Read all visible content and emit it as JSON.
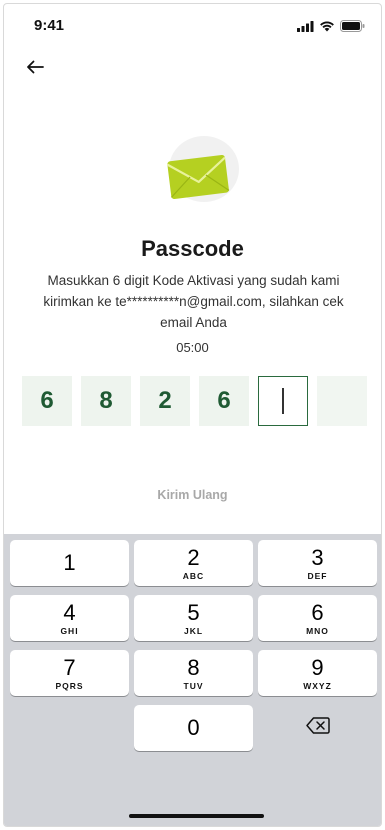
{
  "status_bar": {
    "time": "9:41"
  },
  "page": {
    "title": "Passcode",
    "subtitle": "Masukkan 6 digit Kode Aktivasi yang sudah kami kirimkan ke te**********n@gmail.com, silahkan cek email Anda",
    "timer": "05:00",
    "resend_label": "Kirim Ulang"
  },
  "otp": {
    "digits": [
      "6",
      "8",
      "2",
      "6",
      "",
      ""
    ],
    "active_index": 4
  },
  "keyboard": {
    "keys": [
      {
        "digit": "1",
        "letters": ""
      },
      {
        "digit": "2",
        "letters": "ABC"
      },
      {
        "digit": "3",
        "letters": "DEF"
      },
      {
        "digit": "4",
        "letters": "GHI"
      },
      {
        "digit": "5",
        "letters": "JKL"
      },
      {
        "digit": "6",
        "letters": "MNO"
      },
      {
        "digit": "7",
        "letters": "PQRS"
      },
      {
        "digit": "8",
        "letters": "TUV"
      },
      {
        "digit": "9",
        "letters": "WXYZ"
      },
      {
        "digit": "0",
        "letters": ""
      }
    ]
  },
  "icons": {
    "back": "arrow-left-icon",
    "hero": "envelope-icon",
    "delete": "backspace-icon",
    "signal": "signal-icon",
    "wifi": "wifi-icon",
    "battery": "battery-icon"
  },
  "colors": {
    "accent": "#1f5a33",
    "otp_fill": "#eef4ee",
    "envelope": "#b5d021",
    "keyboard_bg": "#d1d3d8",
    "resend": "#a8a8a8"
  }
}
